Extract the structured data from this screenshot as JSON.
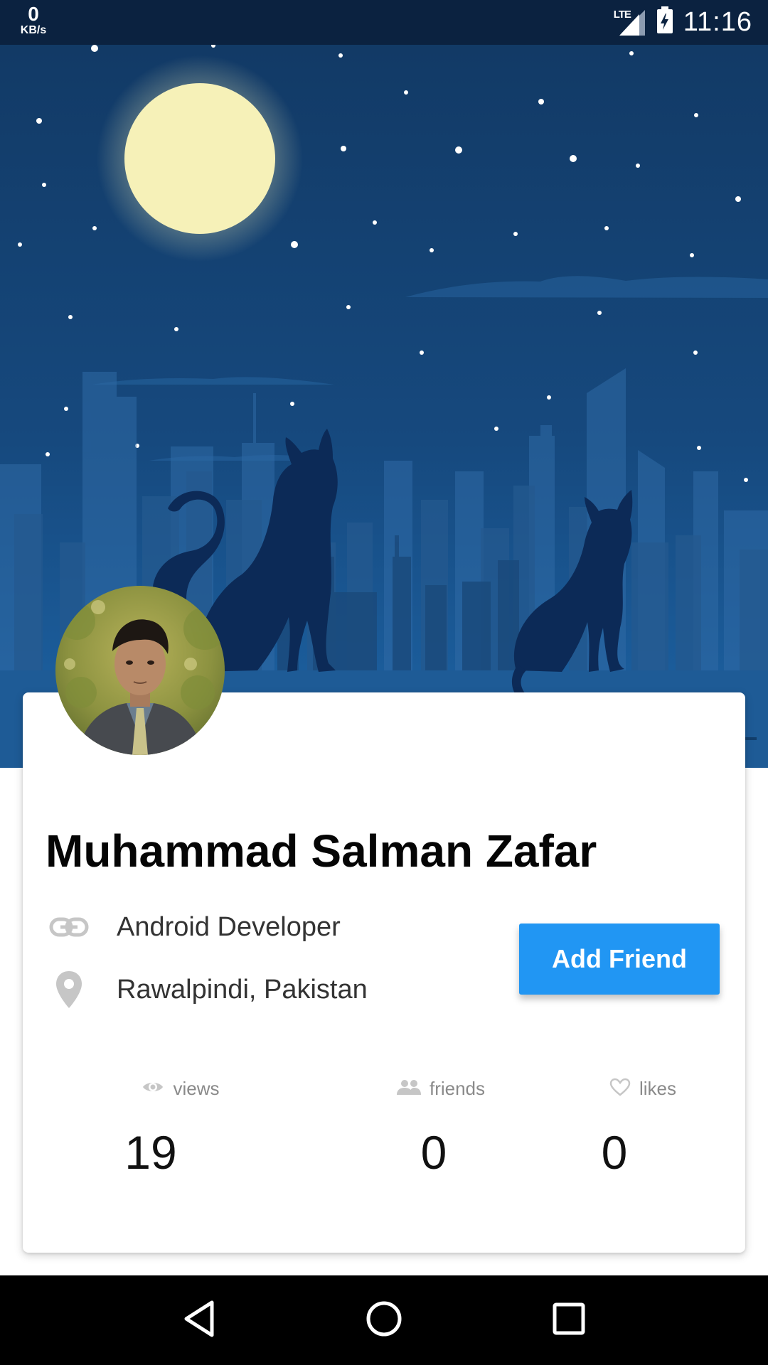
{
  "status_bar": {
    "net_speed_value": "0",
    "net_speed_unit": "KB/s",
    "network_type": "LTE",
    "time": "11:16",
    "icons": [
      "signal-icon",
      "battery-charging-icon"
    ]
  },
  "profile": {
    "name": "Muhammad Salman Zafar",
    "role": "Android Developer",
    "location": "Rawalpindi, Pakistan",
    "add_friend_label": "Add Friend"
  },
  "stats": {
    "views": {
      "label": "views",
      "value": "19",
      "icon": "eye-icon"
    },
    "friends": {
      "label": "friends",
      "value": "0",
      "icon": "people-icon"
    },
    "likes": {
      "label": "likes",
      "value": "0",
      "icon": "heart-icon"
    }
  },
  "colors": {
    "accent": "#2196f3",
    "status_bar": "#0b2240",
    "sky_top": "#123a66",
    "sky_bottom": "#1a5c9a",
    "moon": "#f6f1b8",
    "cat_silhouette": "#0c2a57"
  },
  "nav_bar": {
    "icons": [
      "back-icon",
      "home-icon",
      "recents-icon"
    ]
  }
}
